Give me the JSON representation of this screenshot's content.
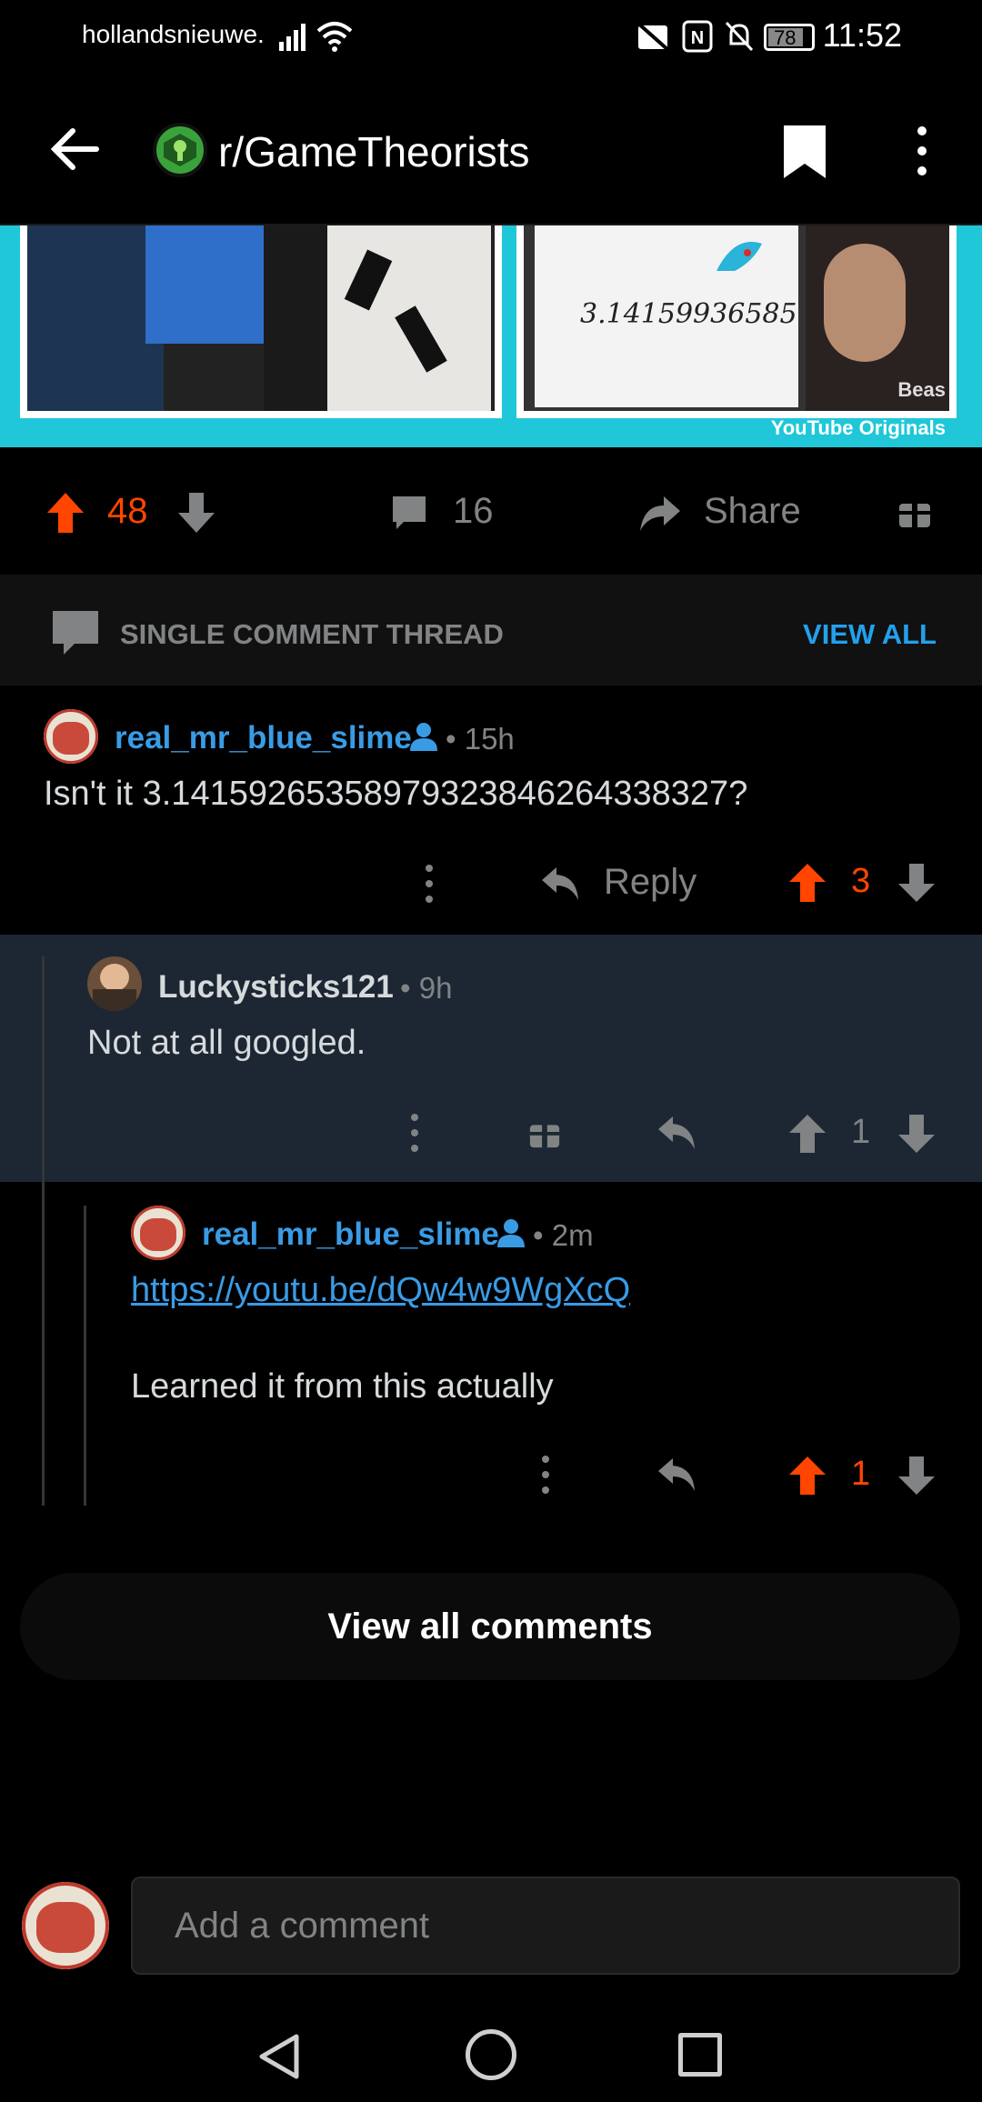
{
  "status_bar": {
    "carrier": "hollandsnieuwe.",
    "time": "11:52",
    "battery": "78"
  },
  "app_bar": {
    "subreddit": "r/GameTheorists"
  },
  "post_actions": {
    "score": "48",
    "comment_count": "16",
    "share_label": "Share"
  },
  "thread_header": {
    "label": "SINGLE COMMENT THREAD",
    "view_all": "VIEW ALL"
  },
  "thumbnail": {
    "whiteboard_text": "3.14159936585",
    "channel_fragment": "Beas",
    "watermark": "YouTube Originals"
  },
  "comments": [
    {
      "author": "real_mr_blue_slime",
      "age": "• 15h",
      "body": "Isn't it 3.14159265358979323846264338327?",
      "reply_label": "Reply",
      "score": "3"
    },
    {
      "author": "Luckysticks121",
      "age": "• 9h",
      "body": "Not at all googled.",
      "score": "1"
    },
    {
      "author": "real_mr_blue_slime",
      "age": "• 2m",
      "link": "https://youtu.be/dQw4w9WgXcQ",
      "body": "Learned it from this actually",
      "score": "1"
    }
  ],
  "view_all_comments": "View all comments",
  "compose": {
    "placeholder": "Add a comment"
  },
  "colors": {
    "upvote": "#ff4500",
    "link": "#3a9be5",
    "muted": "#818384",
    "highlight_bg": "#1c2733"
  }
}
